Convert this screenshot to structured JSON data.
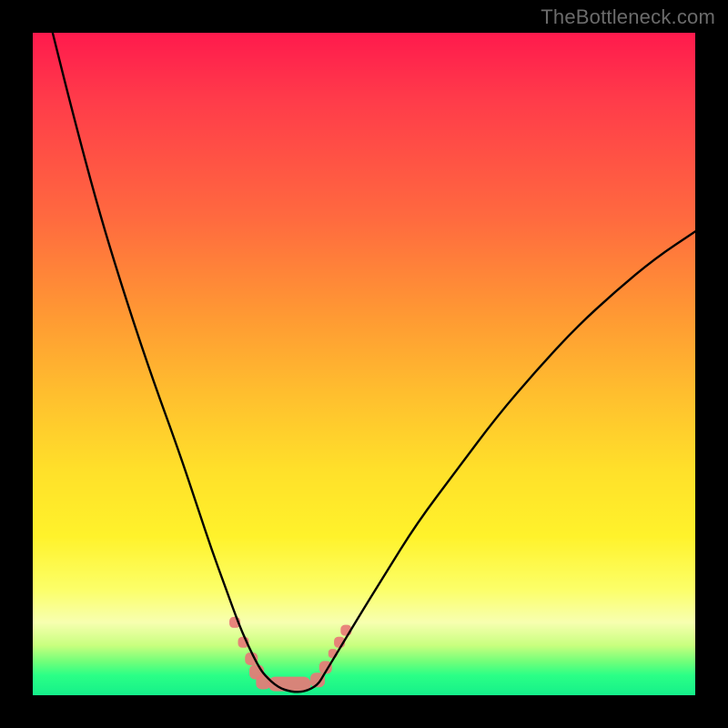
{
  "watermark": {
    "text": "TheBottleneck.com"
  },
  "chart_data": {
    "type": "line",
    "title": "",
    "xlabel": "",
    "ylabel": "",
    "xlim": [
      0,
      100
    ],
    "ylim": [
      0,
      100
    ],
    "grid": false,
    "legend": false,
    "series": [
      {
        "name": "curve",
        "x": [
          3,
          6,
          10,
          14,
          18,
          22,
          25,
          27,
          29,
          31,
          32.5,
          34,
          35,
          37,
          39,
          41,
          43,
          44,
          46,
          49,
          53,
          58,
          64,
          70,
          76,
          82,
          88,
          94,
          100
        ],
        "y": [
          100,
          88,
          73,
          60,
          48,
          37,
          28,
          22,
          16.5,
          11,
          7.5,
          4.5,
          3,
          1.2,
          0.5,
          0.5,
          1.5,
          3.2,
          6.5,
          11.5,
          18,
          26,
          34,
          42,
          49,
          55.5,
          61,
          66,
          70
        ],
        "color": "#000000",
        "linewidth": 2
      }
    ],
    "markers": [
      {
        "name": "left-cluster",
        "shape": "rounded",
        "color": "#e77a77",
        "points": [
          {
            "x": 30.5,
            "y": 11.0,
            "r": 6
          },
          {
            "x": 31.8,
            "y": 8.0,
            "r": 6
          },
          {
            "x": 33.0,
            "y": 5.5,
            "r": 7
          },
          {
            "x": 33.8,
            "y": 3.5,
            "r": 8
          },
          {
            "x": 34.8,
            "y": 2.0,
            "r": 8
          }
        ]
      },
      {
        "name": "bottom-bar",
        "shape": "bar",
        "color": "#e77a77",
        "rect": {
          "x0": 35.5,
          "x1": 42.0,
          "y": 0.6,
          "h": 2.2,
          "r": 8
        }
      },
      {
        "name": "right-cluster",
        "shape": "rounded",
        "color": "#e77a77",
        "points": [
          {
            "x": 43.0,
            "y": 2.3,
            "r": 8
          },
          {
            "x": 44.2,
            "y": 4.2,
            "r": 7
          },
          {
            "x": 45.3,
            "y": 6.3,
            "r": 5
          },
          {
            "x": 46.3,
            "y": 8.0,
            "r": 6
          },
          {
            "x": 47.3,
            "y": 9.8,
            "r": 6
          }
        ]
      }
    ]
  }
}
